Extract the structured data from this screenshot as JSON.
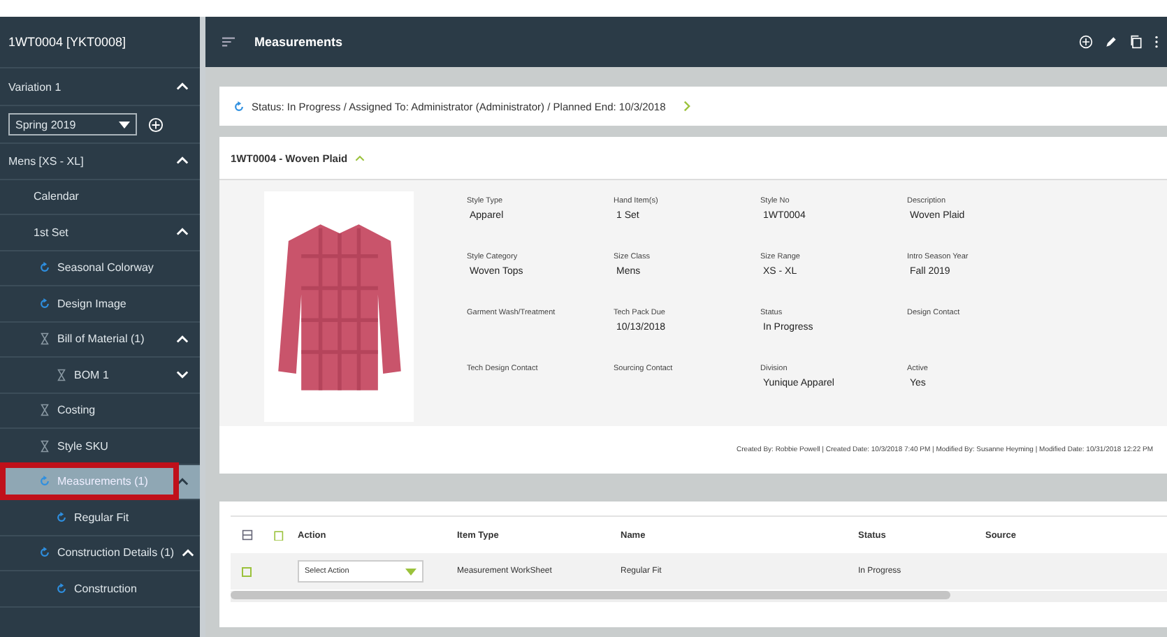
{
  "sidebar": {
    "title": "1WT0004 [YKT0008]",
    "variation": {
      "label": "Variation 1",
      "expanded": true
    },
    "season_select": {
      "value": "Spring 2019"
    },
    "tree": [
      {
        "label": "Mens [XS - XL]",
        "expanded": true,
        "selected": false,
        "children": [
          {
            "label": "Calendar",
            "selected": false
          },
          {
            "label": "1st Set",
            "expanded": true,
            "selected": false,
            "children": [
              {
                "label": "Seasonal Colorway",
                "kind": "cycle",
                "selected": false
              },
              {
                "label": "Design Image",
                "kind": "cycle",
                "selected": false
              },
              {
                "label": "Bill of Material (1)",
                "kind": "hourglass",
                "expanded": true,
                "selected": false,
                "children": [
                  {
                    "label": "BOM 1",
                    "kind": "hourglass",
                    "expanded": false,
                    "selected": false
                  }
                ]
              },
              {
                "label": "Costing",
                "kind": "hourglass",
                "selected": false
              },
              {
                "label": "Style SKU",
                "kind": "hourglass",
                "selected": false
              },
              {
                "label": "Measurements (1)",
                "kind": "cycle",
                "expanded": true,
                "selected": true,
                "children": [
                  {
                    "label": "Regular Fit",
                    "kind": "cycle",
                    "selected": false
                  }
                ]
              },
              {
                "label": "Construction Details (1)",
                "kind": "cycle",
                "expanded": true,
                "selected": false,
                "children": [
                  {
                    "label": "Construction",
                    "kind": "cycle",
                    "selected": false
                  }
                ]
              }
            ]
          }
        ]
      }
    ]
  },
  "header": {
    "title": "Measurements"
  },
  "status_bar": {
    "text": "Status: In Progress / Assigned To: Administrator (Administrator) / Planned End: 10/3/2018"
  },
  "details": {
    "title": "1WT0004 - Woven Plaid",
    "expanded": true,
    "fields": [
      {
        "label": "Style Type",
        "value": "Apparel"
      },
      {
        "label": "Hand Item(s)",
        "value": "1 Set"
      },
      {
        "label": "Style No",
        "value": "1WT0004"
      },
      {
        "label": "Description",
        "value": "Woven Plaid"
      },
      {
        "label": "Style Category",
        "value": "Woven Tops"
      },
      {
        "label": "Size Class",
        "value": "Mens"
      },
      {
        "label": "Size Range",
        "value": "XS - XL"
      },
      {
        "label": "Intro Season Year",
        "value": "Fall 2019"
      },
      {
        "label": "Garment Wash/Treatment"
      },
      {
        "label": "Tech Pack Due",
        "value": "10/13/2018"
      },
      {
        "label": "Status",
        "value": "In Progress"
      },
      {
        "label": "Design Contact"
      },
      {
        "label": "Tech Design Contact"
      },
      {
        "label": "Sourcing Contact"
      },
      {
        "label": "Division",
        "value": "Yunique Apparel"
      },
      {
        "label": "Active",
        "value": "Yes"
      }
    ],
    "footer": "Created By: Robbie Powell | Created Date: 10/3/2018 7:40 PM | Modified By: Susanne Heyming | Modified Date: 10/31/2018 12:22 PM"
  },
  "table": {
    "columns": [
      "Action",
      "Item Type",
      "Name",
      "Status",
      "Source"
    ],
    "rows": [
      {
        "checked": false,
        "cells": [
          "Select Action",
          "Measurement WorkSheet",
          "Regular Fit",
          "In Progress",
          ""
        ]
      }
    ]
  }
}
